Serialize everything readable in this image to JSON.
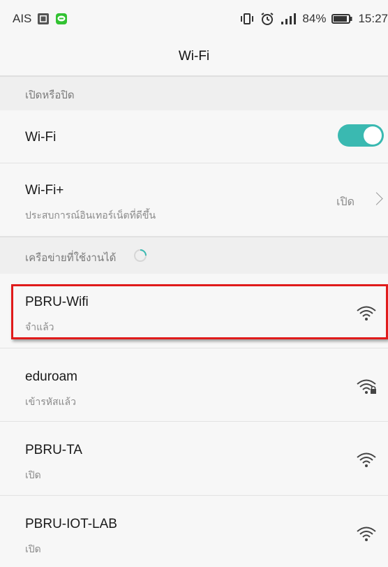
{
  "status_bar": {
    "carrier": "AIS",
    "battery": "84%",
    "time": "15:27",
    "icons": [
      "image-icon",
      "line-app-icon",
      "vibrate-icon",
      "alarm-icon",
      "signal-icon",
      "battery-icon"
    ]
  },
  "app_bar": {
    "title": "Wi-Fi"
  },
  "sections": {
    "onoff": "เปิดหรือปิด",
    "available": "เครือข่ายที่ใช้งานได้"
  },
  "wifi_toggle": {
    "label": "Wi-Fi",
    "state": "on"
  },
  "wifi_plus": {
    "label": "Wi-Fi+",
    "subtitle": "ประสบการณ์อินเทอร์เน็ตที่ดีขึ้น",
    "value": "เปิด"
  },
  "networks": [
    {
      "name": "PBRU-Wifi",
      "status": "จำแล้ว",
      "locked": false
    },
    {
      "name": "eduroam",
      "status": "เข้ารหัสแล้ว",
      "locked": true
    },
    {
      "name": "PBRU-TA",
      "status": "เปิด",
      "locked": false
    },
    {
      "name": "PBRU-IOT-LAB",
      "status": "เปิด",
      "locked": false
    }
  ],
  "colors": {
    "accent": "#3ab9b1",
    "highlight": "#e01b1b"
  }
}
